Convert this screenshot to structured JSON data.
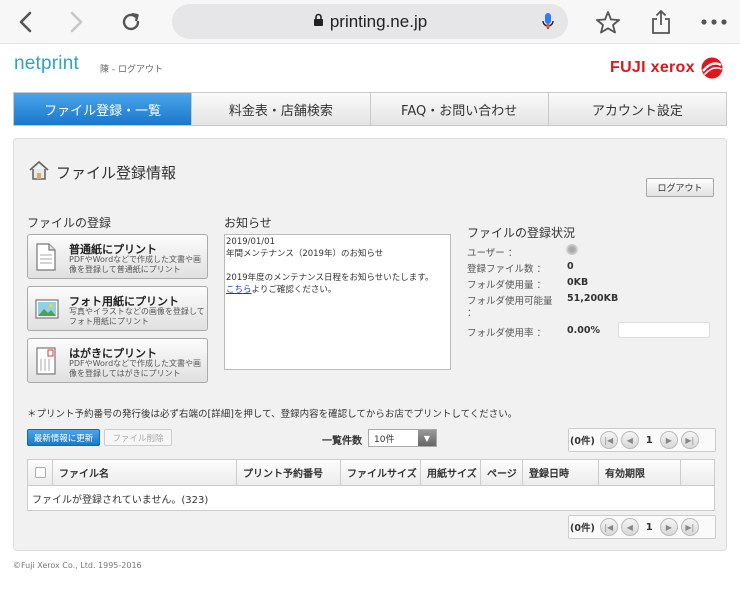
{
  "browser": {
    "url": "printing.ne.jp",
    "back_icon": "chevron-left-icon",
    "forward_icon": "chevron-right-icon",
    "reload_icon": "reload-icon",
    "lock_icon": "lock-icon",
    "mic_icon": "microphone-icon",
    "bookmark_icon": "star-icon",
    "share_icon": "share-icon",
    "more_icon": "more-dots-icon"
  },
  "header": {
    "brand": "netprint",
    "user_name": "陳",
    "logout_link": "ログアウト",
    "separator": " - ",
    "partner_logo": "FUJI xerox",
    "accent": "#2aa4c7",
    "logo_color": "#e0161c"
  },
  "tabs": [
    {
      "label": "ファイル登録・一覧",
      "active": true
    },
    {
      "label": "料金表・店舗検索",
      "active": false
    },
    {
      "label": "FAQ・お問い合わせ",
      "active": false
    },
    {
      "label": "アカウント設定",
      "active": false
    }
  ],
  "main": {
    "title": "ファイル登録情報",
    "logout_button": "ログアウト",
    "register_heading": "ファイルの登録",
    "print_buttons": [
      {
        "title": "普通紙にプリント",
        "description": "PDFやWordなどで作成した文書や画像を登録して普通紙にプリント",
        "icon": "document-icon"
      },
      {
        "title": "フォト用紙にプリント",
        "description": "写真やイラストなどの画像を登録してフォト用紙にプリント",
        "icon": "photo-icon"
      },
      {
        "title": "はがきにプリント",
        "description": "PDFやWordなどで作成した文書や画像を登録してはがきにプリント",
        "icon": "postcard-icon"
      }
    ],
    "news_heading": "お知らせ",
    "news": {
      "date": "2019/01/01",
      "title": "年間メンテナンス（2019年）のお知らせ",
      "body": "2019年度のメンテナンス日程をお知らせいたします。",
      "link": "こちら",
      "link_suffix": "よりご確認ください。"
    },
    "status_heading": "ファイルの登録状況",
    "status": {
      "user_label": "ユーザー ：",
      "file_count_label": "登録ファイル数 ：",
      "file_count": "0",
      "folder_used_label": "フォルダ使用量 ：",
      "folder_used": "0KB",
      "folder_capacity_label": "フォルダ使用可能量",
      "folder_capacity_colon": "：",
      "folder_capacity": "51,200KB",
      "usage_rate_label": "フォルダ使用率 ：",
      "usage_rate": "0.00%"
    },
    "notice": "＊プリント予約番号の発行後は必ず右端の[詳細]を押して、登録内容を確認してからお店でプリントしてください。",
    "refresh_button": "最新情報に更新",
    "delete_button": "ファイル削除",
    "per_page_label": "一覧件数",
    "per_page_value": "10件",
    "pager": {
      "count": "(0件)",
      "page": "1"
    },
    "table": {
      "headers": [
        "ファイル名",
        "プリント予約番号",
        "ファイルサイズ",
        "用紙サイズ",
        "ページ",
        "登録日時",
        "有効期限"
      ],
      "empty_message": "ファイルが登録されていません。(323)"
    }
  },
  "footer": {
    "copyright": "©Fuji Xerox Co., Ltd. 1995-2016"
  },
  "colors": {
    "active_tab": "#1a78cc",
    "panel_bg": "#f1f1f1",
    "link": "#1a3fa8"
  }
}
